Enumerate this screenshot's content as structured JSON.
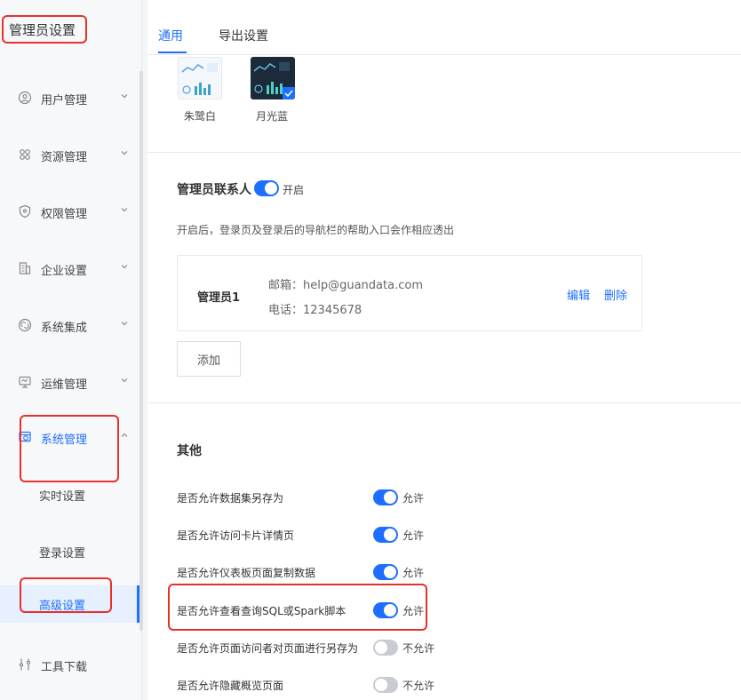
{
  "sidebar": {
    "title": "管理员设置",
    "menu": [
      {
        "label": "用户管理",
        "icon": "user-circle-icon",
        "expanded": false
      },
      {
        "label": "资源管理",
        "icon": "grid-icon",
        "expanded": false
      },
      {
        "label": "权限管理",
        "icon": "shield-icon",
        "expanded": false
      },
      {
        "label": "企业设置",
        "icon": "building-icon",
        "expanded": false
      },
      {
        "label": "系统集成",
        "icon": "integration-icon",
        "expanded": false
      },
      {
        "label": "运维管理",
        "icon": "monitor-icon",
        "expanded": false
      },
      {
        "label": "系统管理",
        "icon": "system-settings-icon",
        "expanded": true
      }
    ],
    "sub_items": [
      {
        "label": "实时设置",
        "active": false
      },
      {
        "label": "登录设置",
        "active": false
      },
      {
        "label": "高级设置",
        "active": true
      }
    ],
    "tools": {
      "label": "工具下载",
      "icon": "tool-icon"
    }
  },
  "tabs": [
    {
      "label": "通用",
      "active": true
    },
    {
      "label": "导出设置",
      "active": false
    }
  ],
  "themes": [
    {
      "label": "朱鹭白",
      "selected": false
    },
    {
      "label": "月光蓝",
      "selected": true
    }
  ],
  "contact": {
    "title": "管理员联系人",
    "switch_on": true,
    "switch_label": "开启",
    "hint": "开启后，登录页及登录后的导航栏的帮助入口会作相应透出",
    "card": {
      "name": "管理员1",
      "email": "邮箱：help@guandata.com",
      "phone": "电话：12345678",
      "edit": "编辑",
      "delete": "删除"
    },
    "add_button": "添加"
  },
  "other": {
    "title": "其他",
    "settings": [
      {
        "label": "是否允许数据集另存为",
        "on": true,
        "state": "允许"
      },
      {
        "label": "是否允许访问卡片详情页",
        "on": true,
        "state": "允许"
      },
      {
        "label": "是否允许仪表板页面复制数据",
        "on": true,
        "state": "允许"
      },
      {
        "label": "是否允许查看查询SQL或Spark脚本",
        "on": true,
        "state": "允许"
      },
      {
        "label": "是否允许页面访问者对页面进行另存为",
        "on": false,
        "state": "不允许"
      },
      {
        "label": "是否允许隐藏概览页面",
        "on": false,
        "state": "不允许"
      }
    ]
  },
  "colors": {
    "accent": "#1e6fff",
    "annotation": "#e8312a"
  }
}
